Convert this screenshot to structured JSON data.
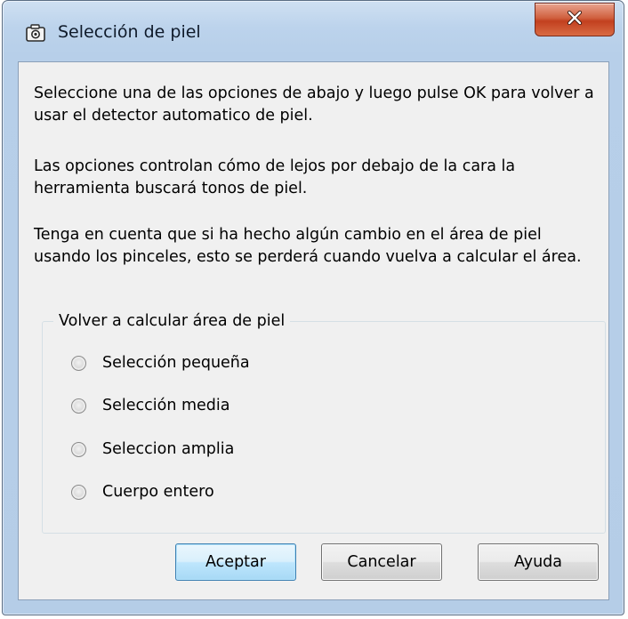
{
  "window": {
    "title": "Selección de piel",
    "title_icon": "camera-icon",
    "close_icon": "close-icon",
    "close_button_color": "#c2401f"
  },
  "body": {
    "paragraph1": "Seleccione una de las opciones de abajo y luego pulse OK para volver a usar el detector automatico de piel.",
    "paragraph2": "Las opciones controlan cómo de lejos por debajo de la cara la herramienta buscará tonos de piel.",
    "paragraph3": "Tenga en cuenta que si ha hecho algún cambio en el área de piel usando los pinceles, esto se perderá cuando vuelva a calcular el área."
  },
  "group": {
    "legend": "Volver a calcular área de piel",
    "options": [
      {
        "label": "Selección pequeña",
        "selected": false
      },
      {
        "label": "Selección media",
        "selected": false
      },
      {
        "label": "Seleccion amplia",
        "selected": false
      },
      {
        "label": "Cuerpo entero",
        "selected": false
      }
    ]
  },
  "buttons": {
    "ok": "Aceptar",
    "cancel": "Cancelar",
    "help": "Ayuda"
  }
}
